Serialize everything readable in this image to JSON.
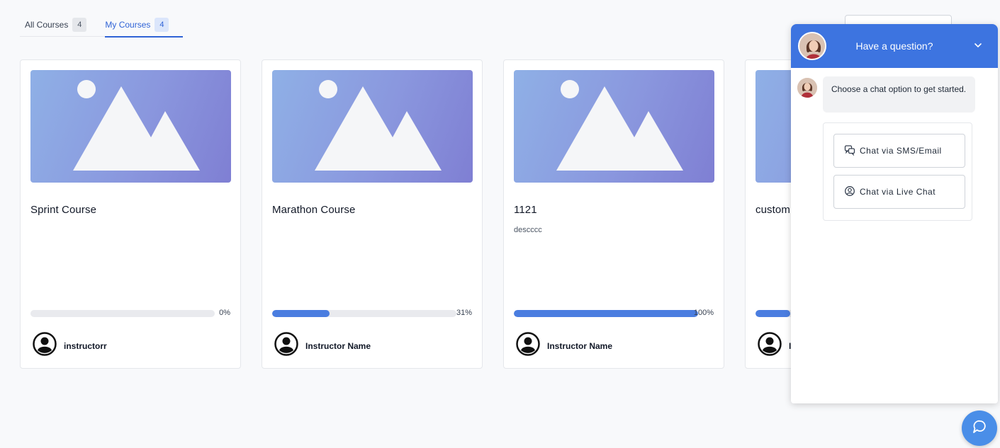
{
  "tabs": [
    {
      "label": "All Courses",
      "count": "4",
      "active": false
    },
    {
      "label": "My Courses",
      "count": "4",
      "active": true
    }
  ],
  "courses": [
    {
      "title": "Sprint Course",
      "description": "",
      "progress": 0,
      "progress_label": "0%",
      "instructor": "instructorr"
    },
    {
      "title": "Marathon Course",
      "description": "",
      "progress": 31,
      "progress_label": "31%",
      "instructor": "Instructor Name"
    },
    {
      "title": "1121",
      "description": "descccc",
      "progress": 100,
      "progress_label": "100%",
      "instructor": "Instructor Name"
    },
    {
      "title": "custom",
      "description": "",
      "progress": 19,
      "progress_label": "",
      "instructor": "I"
    }
  ],
  "chat": {
    "title": "Have a question?",
    "message": "Choose a chat option to get started.",
    "options": [
      {
        "label": "Chat via SMS/Email",
        "icon": "sms-chat-icon"
      },
      {
        "label": "Chat via Live Chat",
        "icon": "live-chat-icon"
      }
    ]
  },
  "colors": {
    "accent": "#2f63d6",
    "progress": "#4a7de0",
    "chat_header": "#3d74e0"
  }
}
